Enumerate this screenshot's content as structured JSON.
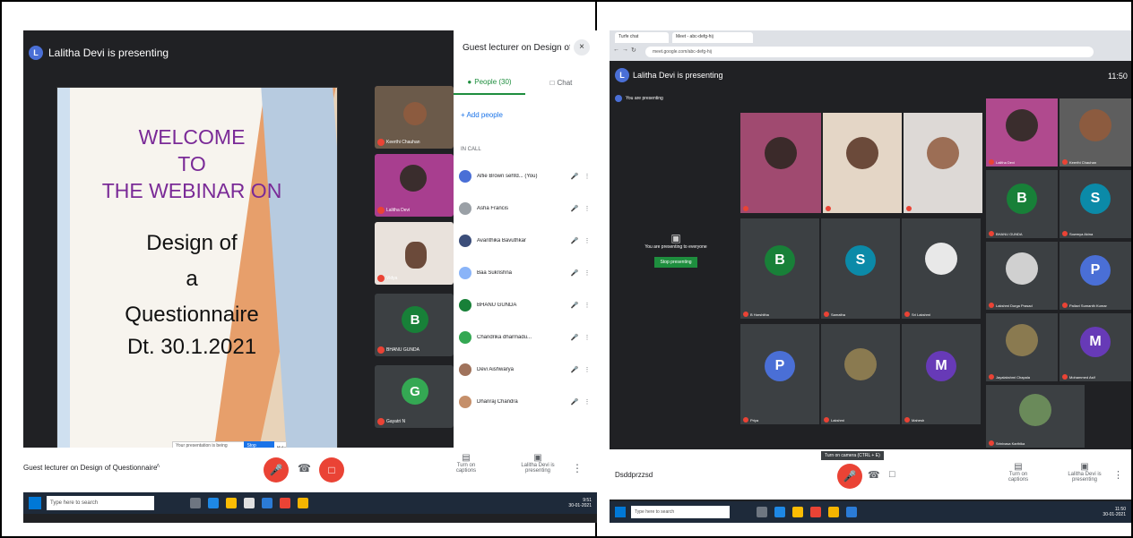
{
  "left_panel": {
    "presenter_avatar": "L",
    "presenting_text": "Lalitha Devi is presenting",
    "slide": {
      "heading_lines": [
        "WELCOME",
        "TO",
        "THE WEBINAR ON"
      ],
      "body_lines": [
        "Design of",
        "a",
        "Questionnaire",
        "Dt. 30.1.2021"
      ]
    },
    "caption_bar": {
      "text": "Your presentation is being recorded",
      "button": "Stop sharing",
      "hide": "Hide"
    },
    "tiles": [
      {
        "name": "Keerthi Chauhan"
      },
      {
        "name": "Lalitha Devi"
      },
      {
        "name": "Vidya"
      },
      {
        "letter": "B",
        "name": "BHANU GUNDA",
        "color": "#188038"
      },
      {
        "letter": "G",
        "name": "Gayatri N",
        "color": "#34a853"
      }
    ],
    "side_panel": {
      "title": "Guest lecturer on Design of Ques...",
      "close": "×",
      "tab_people": "People (30)",
      "tab_chat": "Chat",
      "add_people": "Add people",
      "section_label": "IN CALL",
      "people": [
        {
          "name": "Alfie Brown sehfd... (You)",
          "color": "#4a6fd6"
        },
        {
          "name": "Asha Francis",
          "color": "#9aa0a6"
        },
        {
          "name": "Avanthika Bavuthkar",
          "color": "#3c4e7a"
        },
        {
          "name": "Baa Sukrishna",
          "color": "#8ab4f8"
        },
        {
          "name": "BHANU GUNDA",
          "color": "#188038"
        },
        {
          "name": "Chandrika dharmadu...",
          "color": "#34a853"
        },
        {
          "name": "Devi Aishwarya",
          "color": "#a0735c"
        },
        {
          "name": "Dhanraj Chandra",
          "color": "#c58f6a"
        }
      ]
    },
    "bottom_bar": {
      "meeting_title": "Guest lecturer on Design of Questionnaire",
      "captions_label": "Turn on captions",
      "present_label": "Lalitha Devi is presenting"
    },
    "taskbar": {
      "search_placeholder": "Type here to search",
      "time": "9:51",
      "date": "30-01-2021"
    }
  },
  "right_panel": {
    "browser": {
      "tab1": "Turfe chat",
      "tab2": "Meet - abc-defg-hij",
      "url": "meet.google.com/abc-defg-hij"
    },
    "presenter_avatar": "L",
    "presenting_text": "Lalitha Devi is presenting",
    "sub_text": "You are presenting",
    "header_time": "11:50",
    "presentation_box": {
      "text": "You are presenting to everyone",
      "button": "Stop presenting"
    },
    "tiles": [
      {
        "name": "Lalitha Devi"
      },
      {
        "name": "Keerthi Chauhan"
      },
      {
        "letter": "B",
        "name": "BHANU GUNDA",
        "color": "#188038"
      },
      {
        "letter": "S",
        "name": "Sowmya Akina",
        "color": "#0b8aa8"
      },
      {
        "letter": "B",
        "name": "B Harshitha",
        "color": "#188038"
      },
      {
        "letter": "S",
        "name": "Samatha",
        "color": "#0b8aa8"
      },
      {
        "name": "Sri Lakshmi"
      },
      {
        "name": "Lakshmi Durga Prasad"
      },
      {
        "letter": "P",
        "name": "Pallavi Sumanth Kumar",
        "color": "#4a6fd6"
      },
      {
        "letter": "P",
        "name": "Priya",
        "color": "#4a6fd6"
      },
      {
        "name": "Lakshmi"
      },
      {
        "letter": "M",
        "name": "Mahesh",
        "color": "#673ab7"
      },
      {
        "name": "Jayalakshmi Chapala"
      },
      {
        "letter": "M",
        "name": "Mohammed Asif",
        "color": "#673ab7"
      },
      {
        "name": "Srinivasa Karthika"
      }
    ],
    "bottom_bar": {
      "meeting_title": "Dsddprzzsd",
      "captions_label": "Turn on captions",
      "present_label": "Lalitha Devi is presenting",
      "tooltip": "Turn on camera (CTRL + E)"
    },
    "taskbar": {
      "search_placeholder": "Type here to search",
      "time": "11:50",
      "date": "30-01-2021"
    }
  }
}
